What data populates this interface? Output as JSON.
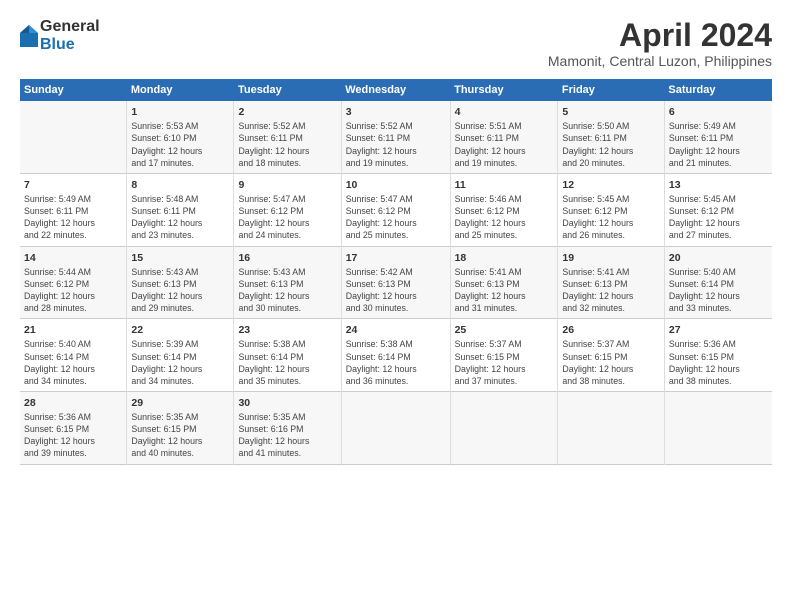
{
  "header": {
    "logo_general": "General",
    "logo_blue": "Blue",
    "month_title": "April 2024",
    "subtitle": "Mamonit, Central Luzon, Philippines"
  },
  "weekdays": [
    "Sunday",
    "Monday",
    "Tuesday",
    "Wednesday",
    "Thursday",
    "Friday",
    "Saturday"
  ],
  "weeks": [
    [
      {
        "day": "",
        "detail": ""
      },
      {
        "day": "1",
        "detail": "Sunrise: 5:53 AM\nSunset: 6:10 PM\nDaylight: 12 hours\nand 17 minutes."
      },
      {
        "day": "2",
        "detail": "Sunrise: 5:52 AM\nSunset: 6:11 PM\nDaylight: 12 hours\nand 18 minutes."
      },
      {
        "day": "3",
        "detail": "Sunrise: 5:52 AM\nSunset: 6:11 PM\nDaylight: 12 hours\nand 19 minutes."
      },
      {
        "day": "4",
        "detail": "Sunrise: 5:51 AM\nSunset: 6:11 PM\nDaylight: 12 hours\nand 19 minutes."
      },
      {
        "day": "5",
        "detail": "Sunrise: 5:50 AM\nSunset: 6:11 PM\nDaylight: 12 hours\nand 20 minutes."
      },
      {
        "day": "6",
        "detail": "Sunrise: 5:49 AM\nSunset: 6:11 PM\nDaylight: 12 hours\nand 21 minutes."
      }
    ],
    [
      {
        "day": "7",
        "detail": "Sunrise: 5:49 AM\nSunset: 6:11 PM\nDaylight: 12 hours\nand 22 minutes."
      },
      {
        "day": "8",
        "detail": "Sunrise: 5:48 AM\nSunset: 6:11 PM\nDaylight: 12 hours\nand 23 minutes."
      },
      {
        "day": "9",
        "detail": "Sunrise: 5:47 AM\nSunset: 6:12 PM\nDaylight: 12 hours\nand 24 minutes."
      },
      {
        "day": "10",
        "detail": "Sunrise: 5:47 AM\nSunset: 6:12 PM\nDaylight: 12 hours\nand 25 minutes."
      },
      {
        "day": "11",
        "detail": "Sunrise: 5:46 AM\nSunset: 6:12 PM\nDaylight: 12 hours\nand 25 minutes."
      },
      {
        "day": "12",
        "detail": "Sunrise: 5:45 AM\nSunset: 6:12 PM\nDaylight: 12 hours\nand 26 minutes."
      },
      {
        "day": "13",
        "detail": "Sunrise: 5:45 AM\nSunset: 6:12 PM\nDaylight: 12 hours\nand 27 minutes."
      }
    ],
    [
      {
        "day": "14",
        "detail": "Sunrise: 5:44 AM\nSunset: 6:12 PM\nDaylight: 12 hours\nand 28 minutes."
      },
      {
        "day": "15",
        "detail": "Sunrise: 5:43 AM\nSunset: 6:13 PM\nDaylight: 12 hours\nand 29 minutes."
      },
      {
        "day": "16",
        "detail": "Sunrise: 5:43 AM\nSunset: 6:13 PM\nDaylight: 12 hours\nand 30 minutes."
      },
      {
        "day": "17",
        "detail": "Sunrise: 5:42 AM\nSunset: 6:13 PM\nDaylight: 12 hours\nand 30 minutes."
      },
      {
        "day": "18",
        "detail": "Sunrise: 5:41 AM\nSunset: 6:13 PM\nDaylight: 12 hours\nand 31 minutes."
      },
      {
        "day": "19",
        "detail": "Sunrise: 5:41 AM\nSunset: 6:13 PM\nDaylight: 12 hours\nand 32 minutes."
      },
      {
        "day": "20",
        "detail": "Sunrise: 5:40 AM\nSunset: 6:14 PM\nDaylight: 12 hours\nand 33 minutes."
      }
    ],
    [
      {
        "day": "21",
        "detail": "Sunrise: 5:40 AM\nSunset: 6:14 PM\nDaylight: 12 hours\nand 34 minutes."
      },
      {
        "day": "22",
        "detail": "Sunrise: 5:39 AM\nSunset: 6:14 PM\nDaylight: 12 hours\nand 34 minutes."
      },
      {
        "day": "23",
        "detail": "Sunrise: 5:38 AM\nSunset: 6:14 PM\nDaylight: 12 hours\nand 35 minutes."
      },
      {
        "day": "24",
        "detail": "Sunrise: 5:38 AM\nSunset: 6:14 PM\nDaylight: 12 hours\nand 36 minutes."
      },
      {
        "day": "25",
        "detail": "Sunrise: 5:37 AM\nSunset: 6:15 PM\nDaylight: 12 hours\nand 37 minutes."
      },
      {
        "day": "26",
        "detail": "Sunrise: 5:37 AM\nSunset: 6:15 PM\nDaylight: 12 hours\nand 38 minutes."
      },
      {
        "day": "27",
        "detail": "Sunrise: 5:36 AM\nSunset: 6:15 PM\nDaylight: 12 hours\nand 38 minutes."
      }
    ],
    [
      {
        "day": "28",
        "detail": "Sunrise: 5:36 AM\nSunset: 6:15 PM\nDaylight: 12 hours\nand 39 minutes."
      },
      {
        "day": "29",
        "detail": "Sunrise: 5:35 AM\nSunset: 6:15 PM\nDaylight: 12 hours\nand 40 minutes."
      },
      {
        "day": "30",
        "detail": "Sunrise: 5:35 AM\nSunset: 6:16 PM\nDaylight: 12 hours\nand 41 minutes."
      },
      {
        "day": "",
        "detail": ""
      },
      {
        "day": "",
        "detail": ""
      },
      {
        "day": "",
        "detail": ""
      },
      {
        "day": "",
        "detail": ""
      }
    ]
  ]
}
